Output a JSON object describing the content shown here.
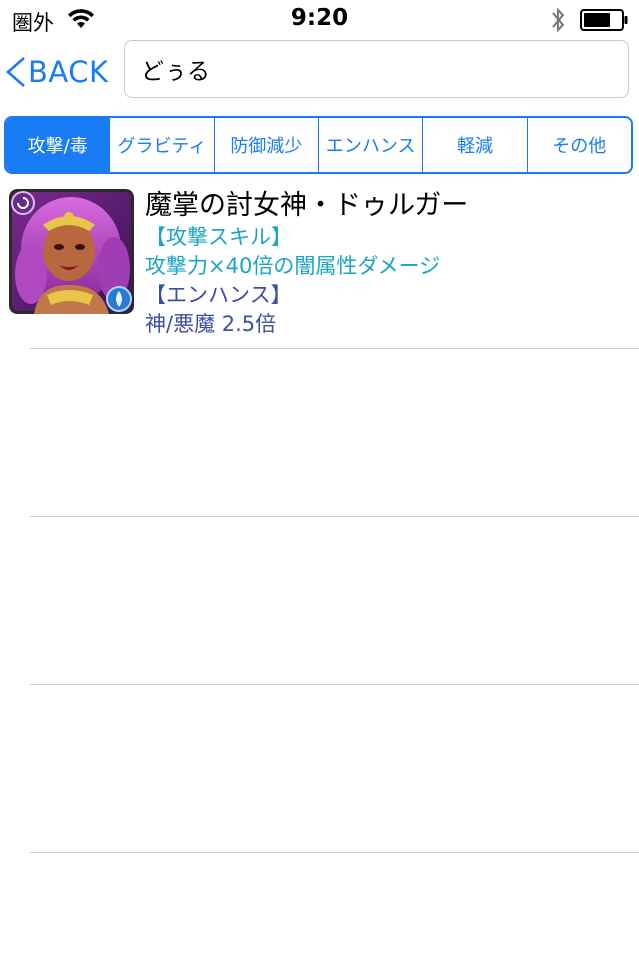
{
  "status_bar": {
    "carrier": "圏外",
    "time": "9:20"
  },
  "nav": {
    "back_label": "BACK"
  },
  "search": {
    "value": "どぅる"
  },
  "segments": [
    {
      "label": "攻撃/毒",
      "selected": true
    },
    {
      "label": "グラビティ",
      "selected": false
    },
    {
      "label": "防御減少",
      "selected": false
    },
    {
      "label": "エンハンス",
      "selected": false
    },
    {
      "label": "軽減",
      "selected": false
    },
    {
      "label": "その他",
      "selected": false
    }
  ],
  "results": [
    {
      "name": "魔掌の討女神・ドゥルガー",
      "skill_header": "【攻撃スキル】",
      "skill_desc": "攻撃力×40倍の闇属性ダメージ",
      "enhance_header": "【エンハンス】",
      "enhance_desc": "神/悪魔 2.5倍"
    }
  ],
  "colors": {
    "accent": "#1a7cf5",
    "skill_text": "#1aa6c4",
    "enhance_text": "#3a4fa6",
    "separator": "#c8c7cc"
  },
  "icons": {
    "signal": "wifi-icon",
    "bluetooth": "bluetooth-icon",
    "battery": "battery-icon",
    "back": "chevron-left-icon",
    "card": "monster-portrait-icon"
  }
}
